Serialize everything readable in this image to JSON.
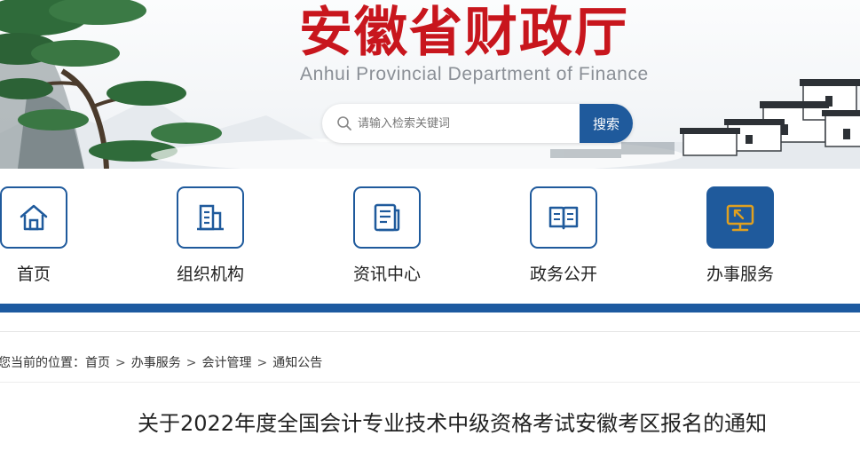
{
  "header": {
    "title": "安徽省财政厅",
    "subtitle": "Anhui Provincial Department of Finance"
  },
  "search": {
    "placeholder": "请输入检索关键词",
    "button_label": "搜索",
    "icon": "search-icon"
  },
  "nav": {
    "items": [
      {
        "label": "首页",
        "icon": "home-icon",
        "active": false
      },
      {
        "label": "组织机构",
        "icon": "building-icon",
        "active": false
      },
      {
        "label": "资讯中心",
        "icon": "news-icon",
        "active": false
      },
      {
        "label": "政务公开",
        "icon": "open-book-icon",
        "active": false
      },
      {
        "label": "办事服务",
        "icon": "monitor-icon",
        "active": true
      }
    ]
  },
  "breadcrumb": {
    "prefix": "您当前的位置：",
    "items": [
      "首页",
      "办事服务",
      "会计管理",
      "通知公告"
    ],
    "separator": ">"
  },
  "article": {
    "title": "关于2022年度全国会计专业技术中级资格考试安徽考区报名的通知"
  },
  "colors": {
    "brand_red": "#c8161d",
    "brand_blue": "#1f5a9c",
    "active_icon": "#e0a020"
  }
}
